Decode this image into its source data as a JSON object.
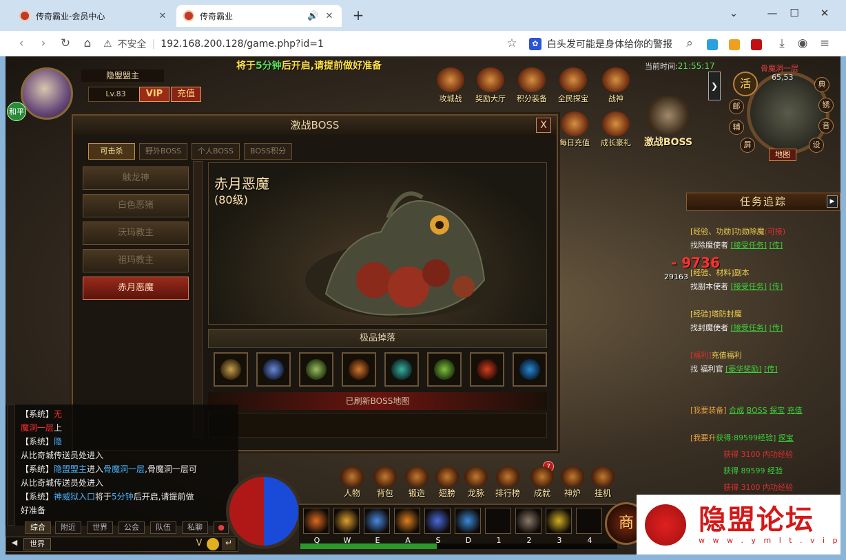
{
  "browser": {
    "tabs": [
      {
        "title": "传奇霸业-会员中心"
      },
      {
        "title": "传奇霸业"
      }
    ],
    "new_tab": "+",
    "window_controls": {
      "minimize": "—",
      "maximize": "☐",
      "close": "✕"
    },
    "address": {
      "security_label": "不安全",
      "url": "192.168.200.128/game.php?id=1"
    },
    "search_text": "白头发可能是身体给你的警报"
  },
  "game": {
    "banner": {
      "pre": "将于",
      "highlight": "5分钟",
      "post": "后开启,请提前做好准备"
    },
    "player": {
      "mode": "和平",
      "name": "隐盟盟主",
      "level": "Lv.83",
      "vip_label": "VIP",
      "charge_label": "充值"
    },
    "clock": {
      "label": "当前时间:",
      "time": "21:55:17"
    },
    "top_icons": [
      {
        "label": "攻城战"
      },
      {
        "label": "奖励大厅"
      },
      {
        "label": "积分装备"
      },
      {
        "label": "全民探宝"
      },
      {
        "label": "战神"
      }
    ],
    "top_icons_row2": [
      {
        "label": "每日充值"
      },
      {
        "label": "成长豪礼"
      }
    ],
    "boss_icon_label": "激战BOSS",
    "activity_label": "活",
    "map": {
      "name": "骨魔洞一层",
      "coord": "65,53",
      "map_button": "地图",
      "buttons_left": [
        "邮",
        "辅",
        "屏"
      ],
      "buttons_right": [
        "典",
        "锈",
        "音",
        "设"
      ]
    },
    "damage": "- 9736",
    "target_hp": "29163",
    "quest": {
      "title": "任务追踪",
      "items": [
        {
          "tag": "[经验、功勋]",
          "name": "功勋除魔",
          "status": "(可接)",
          "npc": "找除魔使者",
          "accept": "[接受任务]",
          "teleport": "[传]"
        },
        {
          "tag": "[经验、材料]",
          "name": "副本",
          "npc": "找副本使者",
          "accept": "[接受任务]",
          "teleport": "[传]"
        },
        {
          "tag": "[经验]",
          "name": "塔防封魔",
          "npc": "找封魔使者",
          "accept": "[接受任务]",
          "teleport": "[传]"
        },
        {
          "tag": "[福利]",
          "name": "充值福利",
          "npc": "找 福利官",
          "accept": "[豪华奖励]",
          "teleport": "[传]"
        }
      ],
      "equip_line": {
        "label": "[我要装备]",
        "links": [
          "合成",
          "BOSS",
          "探宝",
          "充值"
        ]
      },
      "upgrade_line": {
        "label": "[我要升",
        "gain": "获得:89599经验]",
        "link": "探宝"
      },
      "gains": [
        "获得 3100 内功经验",
        "获得 89599 经验",
        "获得 3100 内功经验"
      ]
    },
    "dialog": {
      "title": "激战BOSS",
      "close": "X",
      "tabs": [
        "可击杀",
        "野外BOSS",
        "个人BOSS",
        "BOSS积分"
      ],
      "boss_list": [
        "触龙神",
        "白色恶猪",
        "沃玛教主",
        "祖玛教主",
        "赤月恶魔"
      ],
      "selected_boss": "赤月恶魔",
      "selected_level": "(80级)",
      "drops_title": "极品掉落",
      "drops": [
        {
          "icon": "sword-icon",
          "color": "#c8a050"
        },
        {
          "icon": "sword-icon",
          "color": "#6a8ad8"
        },
        {
          "icon": "sword-icon",
          "color": "#9ac060"
        },
        {
          "icon": "ring-icon",
          "color": "#d07a30"
        },
        {
          "icon": "ring-icon",
          "color": "#3ab0a0"
        },
        {
          "icon": "ring-icon",
          "color": "#80c040"
        },
        {
          "icon": "bracelet-icon",
          "color": "#d04020"
        },
        {
          "icon": "bracelet-icon",
          "color": "#2a8ad0"
        }
      ],
      "refresh_text": "已刷新BOSS地图"
    },
    "chat": {
      "lines": [
        {
          "parts": [
            {
              "t": "【系统】",
              "c": "sys"
            },
            {
              "t": "无",
              "c": "rd"
            }
          ]
        },
        {
          "parts": [
            {
              "t": "魔洞一层",
              "c": "rd"
            },
            {
              "t": "上",
              "c": "sys"
            }
          ]
        },
        {
          "parts": [
            {
              "t": "【系统】",
              "c": "sys"
            },
            {
              "t": "隐",
              "c": "blu"
            }
          ]
        },
        {
          "parts": [
            {
              "t": "从比奇城传送员处进入",
              "c": "sys"
            }
          ]
        },
        {
          "parts": [
            {
              "t": "【系统】",
              "c": "sys"
            },
            {
              "t": "隐盟盟主",
              "c": "blu"
            },
            {
              "t": "进入",
              "c": "sys"
            },
            {
              "t": "骨魔洞一层",
              "c": "blu"
            },
            {
              "t": ",骨魔洞一层可",
              "c": "sys"
            }
          ]
        },
        {
          "parts": [
            {
              "t": "从比奇城传送员处进入",
              "c": "sys"
            }
          ]
        },
        {
          "parts": [
            {
              "t": "【系统】",
              "c": "sys"
            },
            {
              "t": "神威狱入口",
              "c": "blu"
            },
            {
              "t": "将于",
              "c": "sys"
            },
            {
              "t": "5分钟",
              "c": "blu"
            },
            {
              "t": "后开启,请提前做",
              "c": "sys"
            }
          ]
        },
        {
          "parts": [
            {
              "t": "好准备",
              "c": "sys"
            }
          ]
        }
      ],
      "tabs": [
        "综合",
        "附近",
        "世界",
        "公会",
        "队伍",
        "私聊"
      ],
      "channel": "世界"
    },
    "menu": [
      {
        "label": "人物"
      },
      {
        "label": "背包"
      },
      {
        "label": "锻造"
      },
      {
        "label": "翅膀"
      },
      {
        "label": "龙脉"
      },
      {
        "label": "排行榜"
      },
      {
        "label": "成就"
      },
      {
        "label": "神炉"
      },
      {
        "label": "挂机"
      }
    ],
    "achievement_badge": "7",
    "skills": [
      "Q",
      "W",
      "E",
      "A",
      "S",
      "D",
      "1",
      "2",
      "3",
      "4"
    ],
    "skill_colors": [
      "#e06a20",
      "#e0a030",
      "#4a8ae0",
      "#e08020",
      "#4a6ae0",
      "#3a8ad8",
      "",
      "#8a7a6a",
      "#d0b020",
      ""
    ],
    "shop_label": "商",
    "exp_progress": 0.43
  },
  "watermark": {
    "title": "隐盟论坛",
    "url": "w w w . y m l t . v i p"
  }
}
